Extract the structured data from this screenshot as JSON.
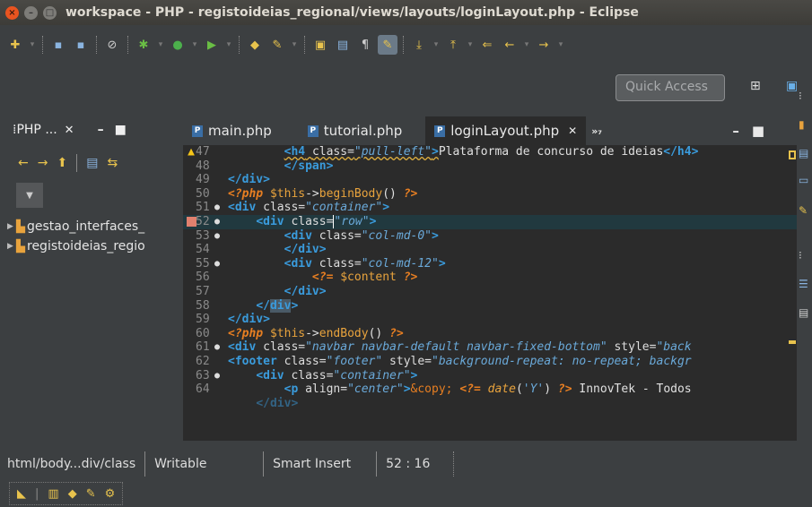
{
  "window": {
    "title": "workspace - PHP - registoideias_regional/views/layouts/loginLayout.php - Eclipse"
  },
  "toolbar": {
    "quick_access": "Quick Access"
  },
  "left_panel": {
    "tab_label": "PHP ...",
    "projects": [
      "gestao_interfaces_",
      "registoideias_regio"
    ]
  },
  "editor_tabs": [
    {
      "label": "main.php"
    },
    {
      "label": "tutorial.php"
    },
    {
      "label": "loginLayout.php",
      "active": true
    }
  ],
  "editor": {
    "line_numbers": [
      "47",
      "48",
      "49",
      "50",
      "51",
      "52",
      "53",
      "54",
      "55",
      "56",
      "57",
      "58",
      "59",
      "60",
      "61",
      "62",
      "63",
      "64"
    ]
  },
  "statusbar": {
    "path": "html/body...div/class",
    "mode": "Writable",
    "insert": "Smart Insert",
    "position": "52 : 16"
  },
  "colors": {
    "tag": "#3a9bdc",
    "value": "#6aa9d9",
    "php": "#e67e22",
    "highlight": "#21393f"
  }
}
